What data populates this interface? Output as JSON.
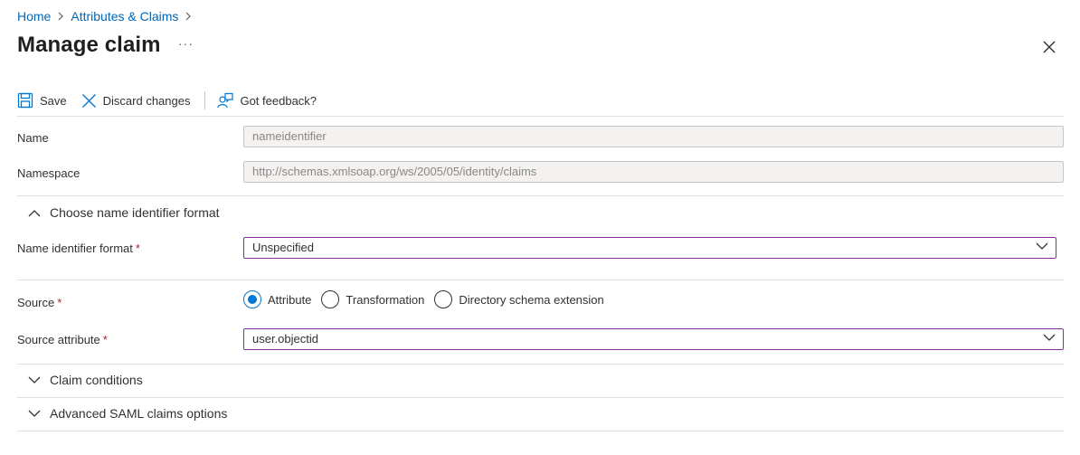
{
  "breadcrumb": {
    "items": [
      {
        "label": "Home"
      },
      {
        "label": "Attributes & Claims"
      }
    ]
  },
  "header": {
    "title": "Manage claim",
    "more_label": "···"
  },
  "toolbar": {
    "save_label": "Save",
    "discard_label": "Discard changes",
    "feedback_label": "Got feedback?"
  },
  "form": {
    "name": {
      "label": "Name",
      "value": "nameidentifier"
    },
    "namespace": {
      "label": "Namespace",
      "value": "http://schemas.xmlsoap.org/ws/2005/05/identity/claims"
    },
    "name_id_section": {
      "label": "Choose name identifier format",
      "expanded": true
    },
    "name_id_format": {
      "label": "Name identifier format",
      "required_mark": "*",
      "value": "Unspecified"
    },
    "source": {
      "label": "Source",
      "required_mark": "*",
      "options": [
        {
          "label": "Attribute",
          "checked": true
        },
        {
          "label": "Transformation",
          "checked": false
        },
        {
          "label": "Directory schema extension",
          "checked": false
        }
      ]
    },
    "source_attribute": {
      "label": "Source attribute",
      "required_mark": "*",
      "value": "user.objectid"
    },
    "claim_conditions": {
      "label": "Claim conditions",
      "expanded": false
    },
    "advanced_saml": {
      "label": "Advanced SAML claims options",
      "expanded": false
    }
  },
  "colors": {
    "link": "#0067b8",
    "accent": "#0078d4",
    "focus_border": "#8a2da5",
    "required": "#a4262c"
  }
}
